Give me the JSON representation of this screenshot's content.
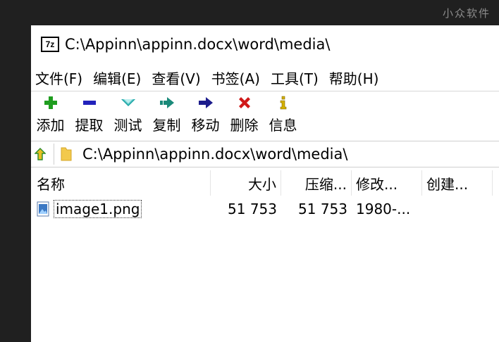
{
  "watermark": "小众软件",
  "window": {
    "app_icon_text": "7z",
    "title": "C:\\Appinn\\appinn.docx\\word\\media\\"
  },
  "menu": [
    {
      "label": "文件(F)"
    },
    {
      "label": "编辑(E)"
    },
    {
      "label": "查看(V)"
    },
    {
      "label": "书签(A)"
    },
    {
      "label": "工具(T)"
    },
    {
      "label": "帮助(H)"
    }
  ],
  "toolbar": [
    {
      "label": "添加",
      "icon": "plus-icon",
      "color": "#1f9d1f"
    },
    {
      "label": "提取",
      "icon": "minus-icon",
      "color": "#2222bb"
    },
    {
      "label": "测试",
      "icon": "check-chevron-icon",
      "color": "#19a3a3"
    },
    {
      "label": "复制",
      "icon": "copy-arrow-icon",
      "color": "#1a8a7a"
    },
    {
      "label": "移动",
      "icon": "move-arrow-icon",
      "color": "#1c1c8c"
    },
    {
      "label": "删除",
      "icon": "delete-x-icon",
      "color": "#d01818"
    },
    {
      "label": "信息",
      "icon": "info-icon",
      "color": "#d4b000"
    }
  ],
  "address": {
    "path": "C:\\Appinn\\appinn.docx\\word\\media\\"
  },
  "columns": {
    "name": "名称",
    "size": "大小",
    "packed": "压缩...",
    "modified": "修改...",
    "created": "创建..."
  },
  "files": [
    {
      "name": "image1.png",
      "size": "51 753",
      "packed": "51 753",
      "modified": "1980-..."
    }
  ]
}
